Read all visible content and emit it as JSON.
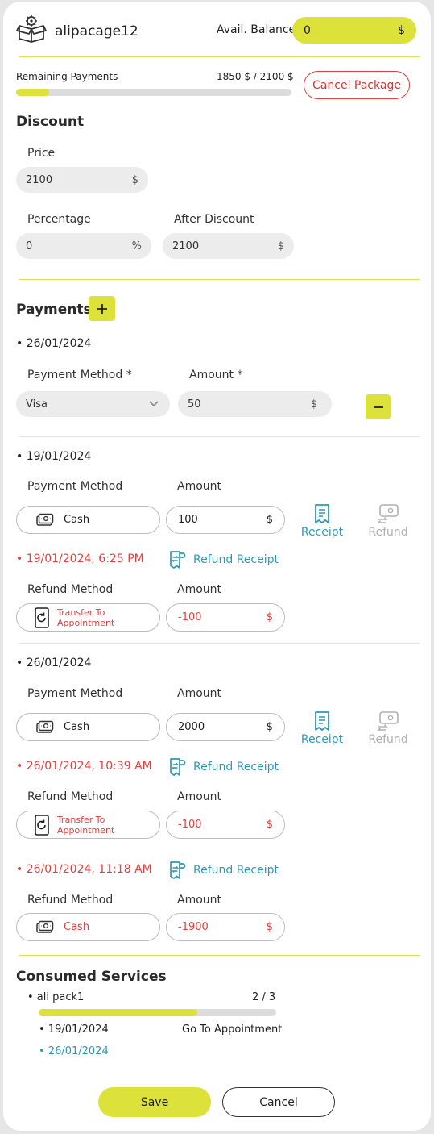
{
  "header": {
    "username": "alipacage12",
    "balance_label": "Avail. Balance",
    "balance_value": "0",
    "balance_currency": "$"
  },
  "package": {
    "remaining_label": "Remaining Payments",
    "remaining_value": "1850 $ / 2100 $",
    "progress_fraction": 0.12,
    "cancel_label": "Cancel Package"
  },
  "discount": {
    "title": "Discount",
    "price_label": "Price",
    "price_value": "2100",
    "price_unit": "$",
    "percentage_label": "Percentage",
    "percentage_value": "0",
    "percentage_unit": "%",
    "after_label": "After Discount",
    "after_value": "2100",
    "after_unit": "$"
  },
  "payments": {
    "title": "Payments",
    "new_entry": {
      "date": "• 26/01/2024",
      "method_label": "Payment Method *",
      "method_value": "Visa",
      "amount_label": "Amount *",
      "amount_value": "50",
      "amount_unit": "$"
    },
    "entries": [
      {
        "date": "• 19/01/2024",
        "method_label": "Payment Method",
        "amount_label": "Amount",
        "method": "Cash",
        "amount": "100",
        "unit": "$",
        "receipt_label": "Receipt",
        "refund_label": "Refund",
        "refunds": [
          {
            "date": "• 19/01/2024, 6:25 PM",
            "receipt_label": "Refund Receipt",
            "method_label": "Refund Method",
            "amount_label": "Amount",
            "method_line1": "Transfer To",
            "method_line2": "Appointment",
            "amount": "-100",
            "unit": "$"
          }
        ]
      },
      {
        "date": "• 26/01/2024",
        "method_label": "Payment Method",
        "amount_label": "Amount",
        "method": "Cash",
        "amount": "2000",
        "unit": "$",
        "receipt_label": "Receipt",
        "refund_label": "Refund",
        "refunds": [
          {
            "date": "• 26/01/2024, 10:39 AM",
            "receipt_label": "Refund Receipt",
            "method_label": "Refund Method",
            "amount_label": "Amount",
            "method_line1": "Transfer To",
            "method_line2": "Appointment",
            "amount": "-100",
            "unit": "$"
          },
          {
            "date": "• 26/01/2024, 11:18 AM",
            "receipt_label": "Refund Receipt",
            "method_label": "Refund Method",
            "amount_label": "Amount",
            "method": "Cash",
            "amount": "-1900",
            "unit": "$"
          }
        ]
      }
    ]
  },
  "consumed": {
    "title": "Consumed Services",
    "service_name": "• ali pack1",
    "service_count": "2 / 3",
    "progress_fraction": 0.667,
    "uses": [
      {
        "date": "• 19/01/2024",
        "action": "Go To Appointment"
      },
      {
        "date": "• 26/01/2024",
        "action": ""
      }
    ]
  },
  "footer": {
    "save_label": "Save",
    "cancel_label": "Cancel"
  },
  "colors": {
    "accent": "#dde23a",
    "teal": "#2a9ab5",
    "red": "#e04040"
  }
}
